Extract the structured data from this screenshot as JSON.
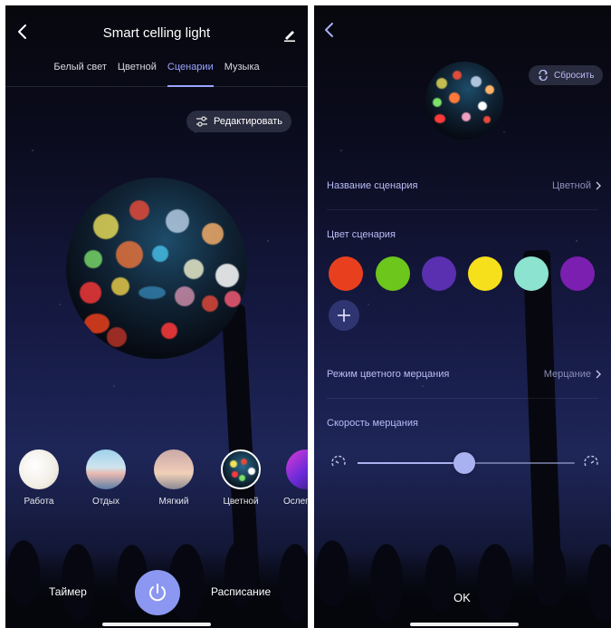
{
  "left": {
    "title": "Smart celling light",
    "tabs": [
      {
        "label": "Белый свет",
        "active": false
      },
      {
        "label": "Цветной",
        "active": false
      },
      {
        "label": "Сценарии",
        "active": true
      },
      {
        "label": "Музыка",
        "active": false
      }
    ],
    "edit_button": "Редактировать",
    "scenes": [
      {
        "label": "Работа",
        "selected": false
      },
      {
        "label": "Отдых",
        "selected": false
      },
      {
        "label": "Мягкий",
        "selected": false
      },
      {
        "label": "Цветной",
        "selected": true
      },
      {
        "label": "Ослепи",
        "selected": false
      }
    ],
    "timer_label": "Таймер",
    "schedule_label": "Расписание"
  },
  "right": {
    "reset_button": "Сбросить",
    "scene_name_label": "Название сценария",
    "scene_name_value": "Цветной",
    "scene_color_label": "Цвет сценария",
    "colors": [
      "#e8401e",
      "#6cc61b",
      "#5a2fb0",
      "#f5e01b",
      "#8be3d0",
      "#7b1fb0"
    ],
    "flicker_mode_label": "Режим цветного мерцания",
    "flicker_mode_value": "Мерцание",
    "flicker_speed_label": "Скорость мерцания",
    "flicker_speed_fraction": 0.49,
    "ok_button": "OK"
  },
  "accent": "#8b97f0"
}
